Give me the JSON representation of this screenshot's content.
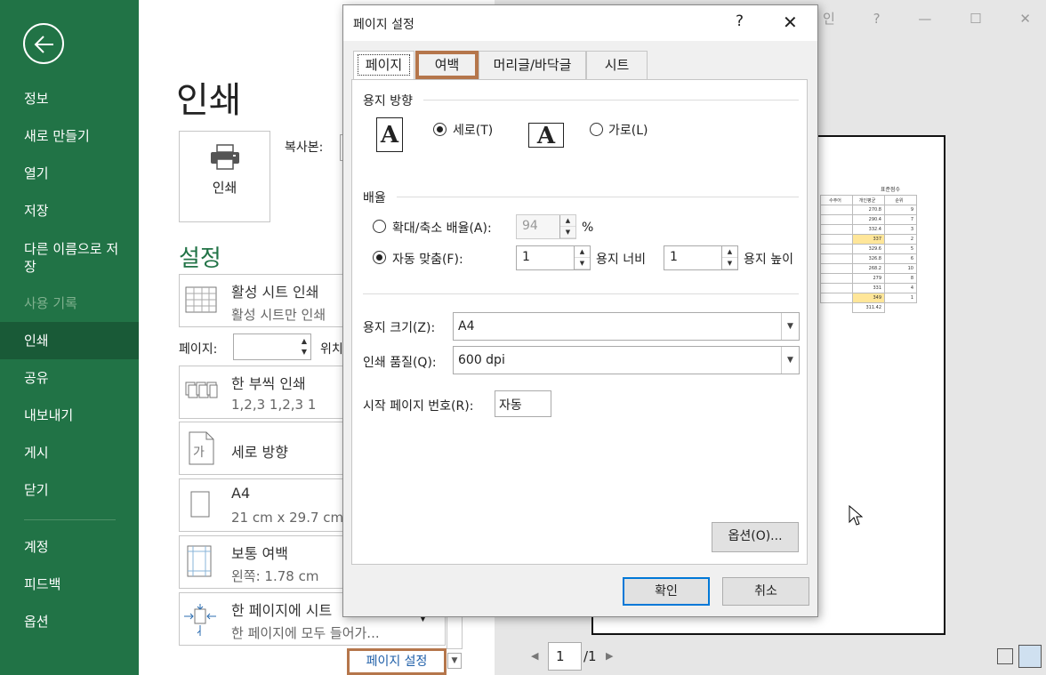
{
  "sidebar": {
    "items": [
      {
        "label": "정보"
      },
      {
        "label": "새로 만들기"
      },
      {
        "label": "열기"
      },
      {
        "label": "저장"
      },
      {
        "label": "다른 이름으로 저장"
      },
      {
        "label": "사용 기록"
      },
      {
        "label": "인쇄"
      },
      {
        "label": "공유"
      },
      {
        "label": "내보내기"
      },
      {
        "label": "게시"
      },
      {
        "label": "닫기"
      },
      {
        "label": "계정"
      },
      {
        "label": "피드백"
      },
      {
        "label": "옵션"
      }
    ]
  },
  "print": {
    "title": "인쇄",
    "print_button": "인쇄",
    "copies_label": "복사본:",
    "settings_title": "설정",
    "rows": [
      {
        "t1": "활성 시트 인쇄",
        "t2": "활성 시트만 인쇄"
      },
      {
        "t1": "한 부씩 인쇄",
        "t2": "1,2,3    1,2,3    1"
      },
      {
        "t1": "세로 방향",
        "t2": ""
      },
      {
        "t1": "A4",
        "t2": "21 cm x 29.7 cm"
      },
      {
        "t1": "보통 여백",
        "t2": "왼쪽:  1.78 cm"
      },
      {
        "t1": "한 페이지에 시트",
        "t2": "한 페이지에 모두 들어가..."
      }
    ],
    "pages_label": "페이지:",
    "pages_to": "위치",
    "page_setup_link": "페이지 설정"
  },
  "preview": {
    "window_controls": [
      "인",
      "?",
      "—",
      "☐",
      "✕"
    ],
    "sheet_caption": "표준점수",
    "sheet_headers": [
      "수주어",
      "개인평균",
      "순위"
    ],
    "sheet_rows": [
      [
        "",
        "270.8",
        "9"
      ],
      [
        "",
        "290.4",
        "7"
      ],
      [
        "",
        "332.4",
        "3"
      ],
      [
        "",
        "337",
        "2"
      ],
      [
        "",
        "329.6",
        "5"
      ],
      [
        "",
        "326.8",
        "6"
      ],
      [
        "",
        "268.2",
        "10"
      ],
      [
        "",
        "279",
        "8"
      ],
      [
        "",
        "331",
        "4"
      ],
      [
        "",
        "349",
        "1"
      ],
      [
        "",
        "311.42",
        ""
      ]
    ],
    "highlight_color": "#ffe699",
    "page_current": "1",
    "page_total": "/1"
  },
  "dialog": {
    "title": "페이지 설정",
    "help": "?",
    "close": "✕",
    "tabs": [
      "페이지",
      "여백",
      "머리글/바닥글",
      "시트"
    ],
    "orientation": {
      "group": "용지 방향",
      "portrait": "세로(T)",
      "landscape": "가로(L)",
      "letter": "A"
    },
    "scaling": {
      "group": "배율",
      "adjust_label": "확대/축소 배율(A):",
      "adjust_value": "94",
      "percent": "%",
      "fit_label": "자동 맞춤(F):",
      "fit_wide_value": "1",
      "fit_wide_label": "용지 너비",
      "fit_tall_value": "1",
      "fit_tall_label": "용지 높이"
    },
    "paper_size_label": "용지 크기(Z):",
    "paper_size_value": "A4",
    "quality_label": "인쇄 품질(Q):",
    "quality_value": "600 dpi",
    "first_page_label": "시작 페이지 번호(R):",
    "first_page_value": "자동",
    "options_button": "옵션(O)...",
    "ok_button": "확인",
    "cancel_button": "취소"
  },
  "colors": {
    "accent": "#217346",
    "highlight_border": "#b5764b",
    "link": "#1f5fa8"
  }
}
